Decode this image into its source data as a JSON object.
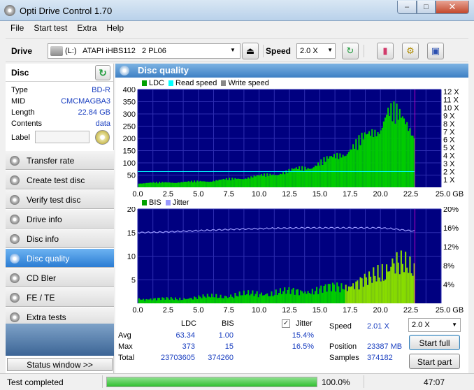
{
  "window": {
    "title": "Opti Drive Control 1.70"
  },
  "menu": [
    "File",
    "Start test",
    "Extra",
    "Help"
  ],
  "toolbar": {
    "drive_label": "Drive",
    "drive_value": "(L:)   ATAPI iHBS112   2 PL06",
    "speed_label": "Speed",
    "speed_value": "2.0 X"
  },
  "disc": {
    "title": "Disc",
    "type_k": "Type",
    "type_v": "BD-R",
    "mid_k": "MID",
    "mid_v": "CMCMAGBA3",
    "length_k": "Length",
    "length_v": "22.84 GB",
    "contents_k": "Contents",
    "contents_v": "data",
    "label_k": "Label"
  },
  "nav": [
    {
      "label": "Transfer rate"
    },
    {
      "label": "Create test disc"
    },
    {
      "label": "Verify test disc"
    },
    {
      "label": "Drive info"
    },
    {
      "label": "Disc info"
    },
    {
      "label": "Disc quality"
    },
    {
      "label": "CD Bler"
    },
    {
      "label": "FE / TE"
    },
    {
      "label": "Extra tests"
    }
  ],
  "status_window_btn": "Status window >>",
  "panel": {
    "title": "Disc quality"
  },
  "chart_data": [
    {
      "type": "area",
      "legend": [
        "LDC",
        "Read speed",
        "Write speed"
      ],
      "colors": {
        "ldc": "#00cc00",
        "read": "#00ffff",
        "write": "#888888"
      },
      "x_ticks": [
        "0.0",
        "2.5",
        "5.0",
        "7.5",
        "10.0",
        "12.5",
        "15.0",
        "17.5",
        "20.0",
        "22.5",
        "25.0 GB"
      ],
      "y_ticks_left": [
        "400",
        "350",
        "300",
        "250",
        "200",
        "150",
        "100",
        "50"
      ],
      "y_ticks_right": [
        "12 X",
        "11 X",
        "10 X",
        "9 X",
        "8 X",
        "7 X",
        "6 X",
        "5 X",
        "4 X",
        "3 X",
        "2 X",
        "1 X"
      ],
      "xlim": [
        0,
        25
      ],
      "ylim": [
        0,
        400
      ],
      "ldc_x": [
        0,
        2,
        4,
        6,
        8,
        10,
        12,
        14,
        16,
        18,
        19,
        20,
        20.5,
        21,
        21.5,
        22,
        22.5,
        22.84
      ],
      "ldc_y": [
        20,
        22,
        25,
        30,
        40,
        52,
        70,
        95,
        135,
        200,
        240,
        300,
        350,
        340,
        320,
        300,
        280,
        260
      ],
      "read_speed_x": 2.0
    },
    {
      "type": "area",
      "legend": [
        "BIS",
        "Jitter"
      ],
      "colors": {
        "bis": "#00cc00",
        "jitter": "#9999ff"
      },
      "x_ticks": [
        "0.0",
        "2.5",
        "5.0",
        "7.5",
        "10.0",
        "12.5",
        "15.0",
        "17.5",
        "20.0",
        "22.5",
        "25.0 GB"
      ],
      "y_ticks_left": [
        "20",
        "15",
        "10",
        "5"
      ],
      "y_ticks_right": [
        "20%",
        "16%",
        "12%",
        "8%",
        "4%"
      ],
      "xlim": [
        0,
        25
      ],
      "ylim": [
        0,
        20
      ],
      "bis_x": [
        0,
        3,
        6,
        9,
        12,
        15,
        17,
        19,
        20,
        21,
        22,
        22.84
      ],
      "bis_y": [
        1,
        1,
        1.5,
        2,
        2.5,
        3,
        4,
        5,
        7,
        10,
        8,
        6
      ],
      "jitter_x": [
        0,
        2,
        5,
        8,
        11,
        14,
        17,
        20,
        21,
        22,
        22.84
      ],
      "jitter_y": [
        15.0,
        15.1,
        15.4,
        15.7,
        15.9,
        16.0,
        16.0,
        16.0,
        15.8,
        15.5,
        15.3
      ]
    }
  ],
  "stats": {
    "col_ldc": "LDC",
    "col_bis": "BIS",
    "col_jitter": "Jitter",
    "avg_k": "Avg",
    "avg_ldc": "63.34",
    "avg_bis": "1.00",
    "avg_jit": "15.4%",
    "max_k": "Max",
    "max_ldc": "373",
    "max_bis": "15",
    "max_jit": "16.5%",
    "total_k": "Total",
    "total_ldc": "23703605",
    "total_bis": "374260",
    "speed_k": "Speed",
    "speed_v": "2.01 X",
    "position_k": "Position",
    "position_v": "23387 MB",
    "samples_k": "Samples",
    "samples_v": "374182",
    "speed_combo": "2.0 X",
    "start_full": "Start full",
    "start_part": "Start part"
  },
  "status": {
    "message": "Test completed",
    "progress": 1.0,
    "percent": "100.0%",
    "time": "47:07"
  }
}
